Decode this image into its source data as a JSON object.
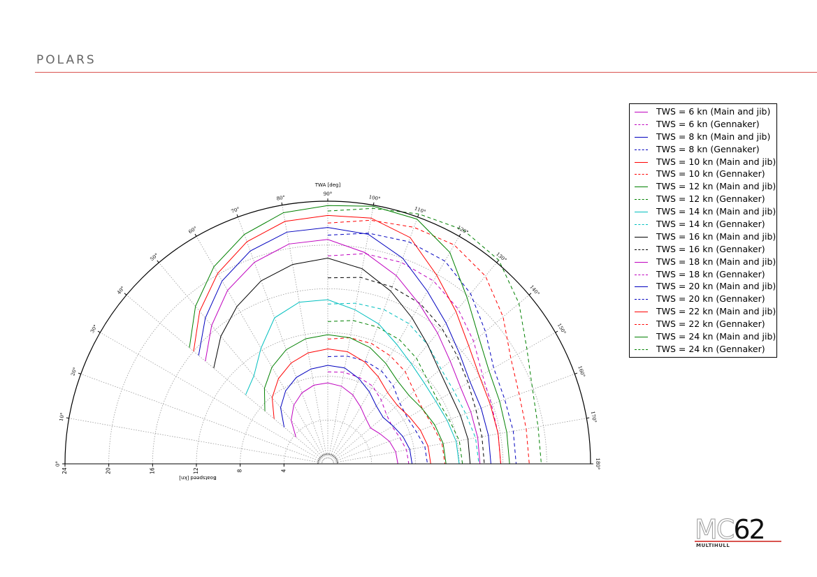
{
  "header": {
    "title": "POLARS"
  },
  "logo": {
    "mark_left": "MC",
    "mark_right": "62",
    "subtitle": "MULTIHULL",
    "accent": "#d9534f"
  },
  "chart_data": {
    "type": "line",
    "polar": true,
    "angle_axis": {
      "label": "TWA [deg]",
      "ticks": [
        "0°",
        "10°",
        "20°",
        "30°",
        "40°",
        "50°",
        "60°",
        "70°",
        "80°",
        "90°",
        "100°",
        "110°",
        "120°",
        "130°",
        "140°",
        "150°",
        "160°",
        "170°",
        "180°"
      ],
      "range": [
        0,
        180
      ]
    },
    "radius_axis": {
      "label": "Boatspeed [kn]",
      "ticks": [
        "24",
        "20",
        "16",
        "12",
        "8",
        "4"
      ],
      "range": [
        0,
        24
      ]
    },
    "grid": true,
    "legend_position": "right",
    "series": [
      {
        "name": "TWS = 6 kn (Main and jib)",
        "color": "#bf00bf",
        "style": "solid",
        "points": [
          [
            40,
            3.8
          ],
          [
            50,
            5.2
          ],
          [
            60,
            6.2
          ],
          [
            70,
            6.9
          ],
          [
            80,
            7.3
          ],
          [
            90,
            7.4
          ],
          [
            100,
            7.2
          ],
          [
            110,
            6.7
          ],
          [
            120,
            6.0
          ],
          [
            130,
            5.4
          ],
          [
            140,
            5.1
          ],
          [
            150,
            5.5
          ],
          [
            160,
            6.0
          ],
          [
            170,
            6.3
          ],
          [
            180,
            6.4
          ]
        ]
      },
      {
        "name": "TWS = 6 kn (Gennaker)",
        "color": "#bf00bf",
        "style": "dashed",
        "points": [
          [
            90,
            8.4
          ],
          [
            100,
            8.5
          ],
          [
            110,
            8.4
          ],
          [
            120,
            8.2
          ],
          [
            130,
            7.6
          ],
          [
            140,
            7.0
          ],
          [
            150,
            6.8
          ],
          [
            160,
            7.0
          ],
          [
            170,
            7.3
          ],
          [
            180,
            7.4
          ]
        ]
      },
      {
        "name": "TWS = 8 kn (Main and jib)",
        "color": "#0000bf",
        "style": "solid",
        "points": [
          [
            40,
            5.2
          ],
          [
            50,
            6.7
          ],
          [
            60,
            7.7
          ],
          [
            70,
            8.4
          ],
          [
            80,
            8.8
          ],
          [
            90,
            9.0
          ],
          [
            100,
            8.9
          ],
          [
            110,
            8.3
          ],
          [
            120,
            7.6
          ],
          [
            130,
            6.9
          ],
          [
            140,
            6.6
          ],
          [
            150,
            6.9
          ],
          [
            160,
            7.3
          ],
          [
            170,
            7.6
          ],
          [
            180,
            7.7
          ]
        ]
      },
      {
        "name": "TWS = 8 kn (Gennaker)",
        "color": "#0000bf",
        "style": "dashed",
        "points": [
          [
            90,
            9.8
          ],
          [
            100,
            10.0
          ],
          [
            110,
            10.0
          ],
          [
            120,
            9.8
          ],
          [
            130,
            9.3
          ],
          [
            140,
            8.6
          ],
          [
            150,
            8.4
          ],
          [
            160,
            8.6
          ],
          [
            170,
            9.0
          ],
          [
            180,
            9.1
          ]
        ]
      },
      {
        "name": "TWS = 10 kn (Main and jib)",
        "color": "#ff0000",
        "style": "solid",
        "points": [
          [
            40,
            6.4
          ],
          [
            50,
            7.9
          ],
          [
            60,
            9.0
          ],
          [
            70,
            9.8
          ],
          [
            80,
            10.3
          ],
          [
            90,
            10.5
          ],
          [
            100,
            10.4
          ],
          [
            110,
            9.9
          ],
          [
            120,
            9.2
          ],
          [
            130,
            8.5
          ],
          [
            140,
            8.3
          ],
          [
            150,
            8.6
          ],
          [
            160,
            9.0
          ],
          [
            170,
            9.3
          ],
          [
            180,
            9.4
          ]
        ]
      },
      {
        "name": "TWS = 10 kn (Gennaker)",
        "color": "#ff0000",
        "style": "dashed",
        "points": [
          [
            90,
            11.4
          ],
          [
            100,
            11.7
          ],
          [
            110,
            11.7
          ],
          [
            120,
            11.4
          ],
          [
            130,
            11.0
          ],
          [
            140,
            10.3
          ],
          [
            150,
            10.0
          ],
          [
            160,
            10.2
          ],
          [
            170,
            10.6
          ],
          [
            180,
            10.7
          ]
        ]
      },
      {
        "name": "TWS = 12 kn (Main and jib)",
        "color": "#008000",
        "style": "solid",
        "points": [
          [
            40,
            7.5
          ],
          [
            50,
            9.0
          ],
          [
            60,
            10.2
          ],
          [
            70,
            11.1
          ],
          [
            80,
            11.6
          ],
          [
            90,
            11.8
          ],
          [
            100,
            11.7
          ],
          [
            110,
            11.3
          ],
          [
            120,
            10.6
          ],
          [
            130,
            9.9
          ],
          [
            140,
            9.7
          ],
          [
            150,
            10.0
          ],
          [
            160,
            10.4
          ],
          [
            170,
            10.7
          ],
          [
            180,
            10.8
          ]
        ]
      },
      {
        "name": "TWS = 12 kn (Gennaker)",
        "color": "#008000",
        "style": "dashed",
        "points": [
          [
            90,
            13.0
          ],
          [
            100,
            13.3
          ],
          [
            110,
            13.3
          ],
          [
            120,
            13.1
          ],
          [
            130,
            12.6
          ],
          [
            140,
            11.9
          ],
          [
            150,
            11.6
          ],
          [
            160,
            11.8
          ],
          [
            170,
            12.2
          ],
          [
            180,
            12.3
          ]
        ]
      },
      {
        "name": "TWS = 14 kn (Main and jib)",
        "color": "#00bfbf",
        "style": "solid",
        "points": [
          [
            40,
            9.8
          ],
          [
            50,
            10.5
          ],
          [
            60,
            12.2
          ],
          [
            70,
            14.2
          ],
          [
            80,
            15.0
          ],
          [
            90,
            15.0
          ],
          [
            100,
            14.3
          ],
          [
            110,
            13.6
          ],
          [
            120,
            12.6
          ],
          [
            130,
            11.9
          ],
          [
            140,
            11.5
          ],
          [
            150,
            11.4
          ],
          [
            160,
            11.6
          ],
          [
            170,
            11.9
          ],
          [
            180,
            12.0
          ]
        ]
      },
      {
        "name": "TWS = 14 kn (Gennaker)",
        "color": "#00bfbf",
        "style": "dashed",
        "points": [
          [
            90,
            14.6
          ],
          [
            100,
            14.9
          ],
          [
            110,
            15.0
          ],
          [
            120,
            14.8
          ],
          [
            130,
            14.2
          ],
          [
            140,
            13.5
          ],
          [
            150,
            13.3
          ],
          [
            160,
            13.4
          ],
          [
            170,
            13.7
          ],
          [
            180,
            13.8
          ]
        ]
      },
      {
        "name": "TWS = 16 kn (Main and jib)",
        "color": "#000000",
        "style": "solid",
        "points": [
          [
            40,
            13.6
          ],
          [
            50,
            15.2
          ],
          [
            60,
            16.6
          ],
          [
            70,
            17.8
          ],
          [
            80,
            18.5
          ],
          [
            90,
            18.8
          ],
          [
            100,
            18.1
          ],
          [
            110,
            16.8
          ],
          [
            120,
            15.4
          ],
          [
            130,
            14.2
          ],
          [
            140,
            13.3
          ],
          [
            150,
            12.9
          ],
          [
            160,
            12.9
          ],
          [
            170,
            13.0
          ],
          [
            180,
            13.0
          ]
        ]
      },
      {
        "name": "TWS = 16 kn (Gennaker)",
        "color": "#000000",
        "style": "dashed",
        "points": [
          [
            90,
            17.0
          ],
          [
            100,
            17.3
          ],
          [
            110,
            17.2
          ],
          [
            120,
            16.9
          ],
          [
            130,
            16.2
          ],
          [
            140,
            15.4
          ],
          [
            150,
            14.8
          ],
          [
            160,
            14.4
          ],
          [
            170,
            14.3
          ],
          [
            180,
            14.3
          ]
        ]
      },
      {
        "name": "TWS = 18 kn (Main and jib)",
        "color": "#bf00bf",
        "style": "solid",
        "points": [
          [
            40,
            14.6
          ],
          [
            50,
            16.5
          ],
          [
            60,
            18.3
          ],
          [
            70,
            19.6
          ],
          [
            80,
            20.4
          ],
          [
            90,
            20.5
          ],
          [
            100,
            19.6
          ],
          [
            110,
            18.3
          ],
          [
            120,
            16.8
          ],
          [
            130,
            15.6
          ],
          [
            140,
            14.6
          ],
          [
            150,
            14.0
          ],
          [
            160,
            13.9
          ],
          [
            170,
            13.9
          ],
          [
            180,
            13.9
          ]
        ]
      },
      {
        "name": "TWS = 18 kn (Gennaker)",
        "color": "#bf00bf",
        "style": "dashed",
        "points": [
          [
            90,
            19.0
          ],
          [
            100,
            19.5
          ],
          [
            110,
            19.6
          ],
          [
            120,
            19.3
          ],
          [
            130,
            18.5
          ],
          [
            140,
            17.4
          ],
          [
            150,
            16.3
          ],
          [
            160,
            15.9
          ],
          [
            170,
            15.8
          ],
          [
            180,
            15.8
          ]
        ]
      },
      {
        "name": "TWS = 20 kn (Main and jib)",
        "color": "#0000bf",
        "style": "solid",
        "points": [
          [
            40,
            15.4
          ],
          [
            50,
            17.4
          ],
          [
            60,
            19.3
          ],
          [
            70,
            20.7
          ],
          [
            80,
            21.5
          ],
          [
            90,
            21.6
          ],
          [
            100,
            21.3
          ],
          [
            110,
            20.0
          ],
          [
            120,
            18.2
          ],
          [
            130,
            16.8
          ],
          [
            140,
            15.7
          ],
          [
            150,
            15.0
          ],
          [
            160,
            14.9
          ],
          [
            170,
            14.9
          ],
          [
            180,
            14.9
          ]
        ]
      },
      {
        "name": "TWS = 20 kn (Gennaker)",
        "color": "#0000bf",
        "style": "dashed",
        "points": [
          [
            90,
            20.9
          ],
          [
            100,
            21.4
          ],
          [
            110,
            21.6
          ],
          [
            120,
            21.4
          ],
          [
            130,
            20.3
          ],
          [
            140,
            18.8
          ],
          [
            150,
            17.5
          ],
          [
            160,
            17.2
          ],
          [
            170,
            17.2
          ],
          [
            180,
            17.2
          ]
        ]
      },
      {
        "name": "TWS = 22 kn (Main and jib)",
        "color": "#ff0000",
        "style": "solid",
        "points": [
          [
            40,
            16.0
          ],
          [
            50,
            18.2
          ],
          [
            60,
            20.1
          ],
          [
            70,
            21.6
          ],
          [
            80,
            22.5
          ],
          [
            90,
            22.7
          ],
          [
            100,
            22.8
          ],
          [
            110,
            22.0
          ],
          [
            120,
            19.9
          ],
          [
            130,
            18.2
          ],
          [
            140,
            16.8
          ],
          [
            150,
            16.0
          ],
          [
            160,
            15.8
          ],
          [
            170,
            15.8
          ],
          [
            180,
            15.8
          ]
        ]
      },
      {
        "name": "TWS = 22 kn (Gennaker)",
        "color": "#ff0000",
        "style": "dashed",
        "points": [
          [
            90,
            22.0
          ],
          [
            100,
            22.6
          ],
          [
            110,
            23.0
          ],
          [
            120,
            23.1
          ],
          [
            130,
            22.4
          ],
          [
            140,
            20.9
          ],
          [
            150,
            19.3
          ],
          [
            160,
            18.6
          ],
          [
            170,
            18.4
          ],
          [
            180,
            18.4
          ]
        ]
      },
      {
        "name": "TWS = 24 kn (Main and jib)",
        "color": "#008000",
        "style": "solid",
        "points": [
          [
            40,
            16.5
          ],
          [
            50,
            18.8
          ],
          [
            60,
            20.8
          ],
          [
            70,
            22.3
          ],
          [
            80,
            23.3
          ],
          [
            90,
            23.6
          ],
          [
            100,
            23.9
          ],
          [
            110,
            23.8
          ],
          [
            120,
            22.3
          ],
          [
            130,
            19.8
          ],
          [
            140,
            18.0
          ],
          [
            150,
            17.0
          ],
          [
            160,
            16.7
          ],
          [
            170,
            16.6
          ],
          [
            180,
            16.6
          ]
        ]
      },
      {
        "name": "TWS = 24 kn (Gennaker)",
        "color": "#008000",
        "style": "dashed",
        "points": [
          [
            90,
            23.1
          ],
          [
            100,
            23.7
          ],
          [
            110,
            24.3
          ],
          [
            120,
            24.7
          ],
          [
            130,
            24.3
          ],
          [
            140,
            22.8
          ],
          [
            150,
            21.0
          ],
          [
            160,
            19.9
          ],
          [
            170,
            19.5
          ],
          [
            180,
            19.5
          ]
        ]
      }
    ]
  }
}
